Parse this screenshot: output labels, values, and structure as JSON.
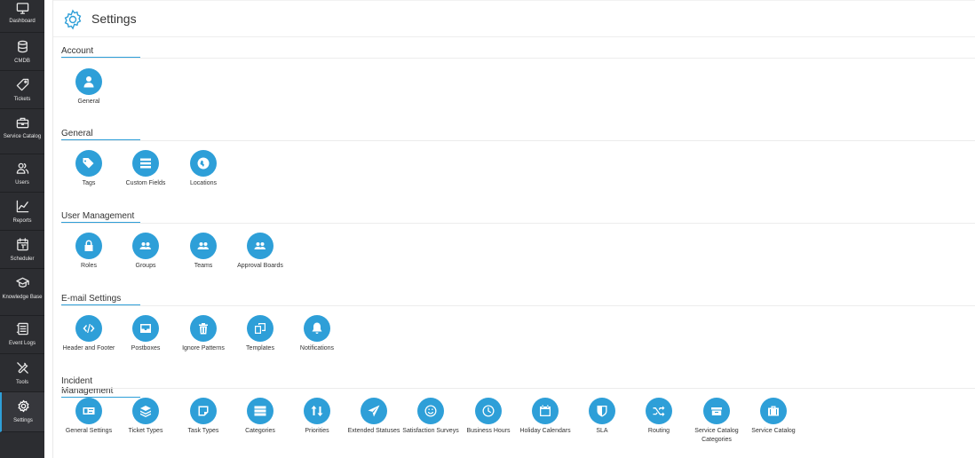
{
  "sidebar": {
    "items": [
      {
        "label": "Dashboard",
        "icon": "monitor-icon"
      },
      {
        "label": "CMDB",
        "icon": "database-icon"
      },
      {
        "label": "Tickets",
        "icon": "tag-icon"
      },
      {
        "label": "Service Catalog",
        "icon": "briefcase-icon"
      },
      {
        "label": "Users",
        "icon": "users-icon"
      },
      {
        "label": "Reports",
        "icon": "chart-icon"
      },
      {
        "label": "Scheduler",
        "icon": "calendar-icon"
      },
      {
        "label": "Knowledge Base",
        "icon": "graduation-cap-icon"
      },
      {
        "label": "Event Logs",
        "icon": "log-icon"
      },
      {
        "label": "Tools",
        "icon": "tools-icon"
      },
      {
        "label": "Settings",
        "icon": "gear-icon"
      }
    ],
    "active": "Settings"
  },
  "page": {
    "title": "Settings",
    "accent": "#2e9fd8",
    "sidebar_bg": "#2c2d31"
  },
  "sections": [
    {
      "title": "Account",
      "items": [
        {
          "label": "General",
          "icon": "user-icon"
        }
      ]
    },
    {
      "title": "General",
      "items": [
        {
          "label": "Tags",
          "icon": "tags-icon"
        },
        {
          "label": "Custom Fields",
          "icon": "list-icon"
        },
        {
          "label": "Locations",
          "icon": "globe-icon"
        }
      ]
    },
    {
      "title": "User Management",
      "items": [
        {
          "label": "Roles",
          "icon": "lock-icon"
        },
        {
          "label": "Groups",
          "icon": "group-icon"
        },
        {
          "label": "Teams",
          "icon": "team-icon"
        },
        {
          "label": "Approval Boards",
          "icon": "approval-icon"
        }
      ]
    },
    {
      "title": "E-mail Settings",
      "items": [
        {
          "label": "Header and Footer",
          "icon": "code-icon"
        },
        {
          "label": "Postboxes",
          "icon": "inbox-icon"
        },
        {
          "label": "Ignore Patterns",
          "icon": "trash-icon"
        },
        {
          "label": "Templates",
          "icon": "copy-icon"
        },
        {
          "label": "Notifications",
          "icon": "bell-icon"
        }
      ]
    },
    {
      "title": "Incident Management",
      "items": [
        {
          "label": "General Settings",
          "icon": "id-card-icon"
        },
        {
          "label": "Ticket Types",
          "icon": "layers-icon"
        },
        {
          "label": "Task Types",
          "icon": "note-icon"
        },
        {
          "label": "Categories",
          "icon": "server-icon"
        },
        {
          "label": "Priorities",
          "icon": "sort-icon"
        },
        {
          "label": "Extended Statuses",
          "icon": "send-icon"
        },
        {
          "label": "Satisfaction Surveys",
          "icon": "smile-icon"
        },
        {
          "label": "Business Hours",
          "icon": "clock-icon"
        },
        {
          "label": "Holiday Calendars",
          "icon": "calendar-icon"
        },
        {
          "label": "SLA",
          "icon": "shield-icon"
        },
        {
          "label": "Routing",
          "icon": "shuffle-icon"
        },
        {
          "label": "Service Catalog Categories",
          "icon": "archive-icon"
        },
        {
          "label": "Service Catalog",
          "icon": "briefcase-icon"
        }
      ]
    }
  ]
}
